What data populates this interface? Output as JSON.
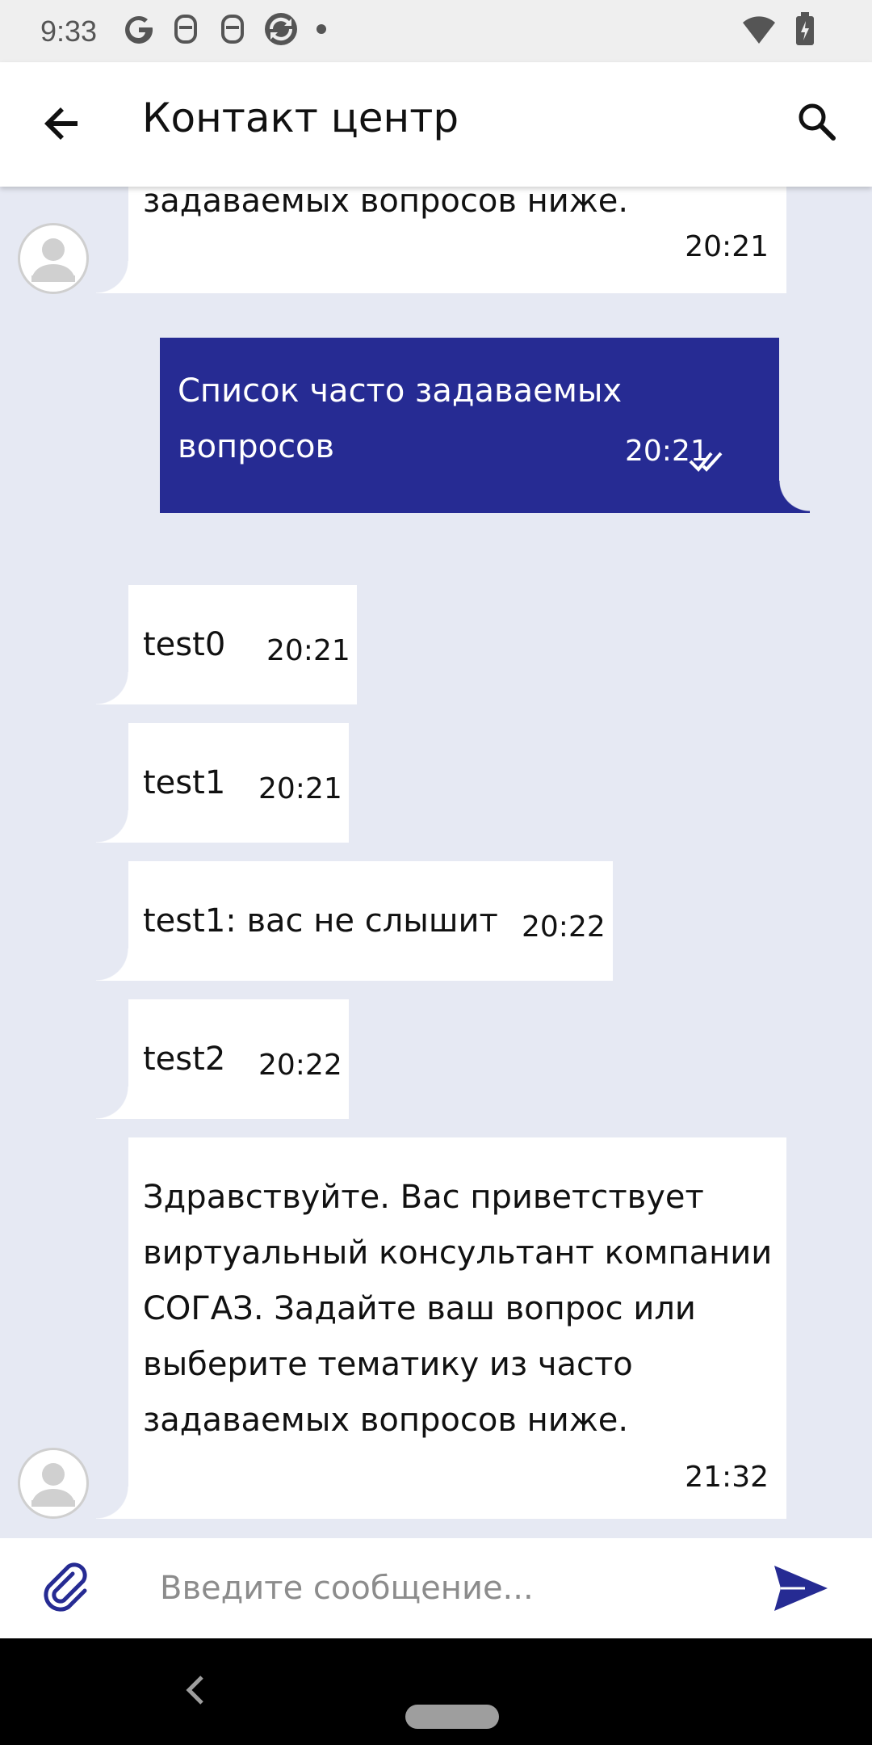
{
  "status_bar": {
    "time": "9:33",
    "icons": [
      "google-icon",
      "notification-icon",
      "notification-icon",
      "sync-icon",
      "dot-icon"
    ],
    "right_icons": [
      "wifi-icon",
      "battery-charging-icon"
    ]
  },
  "app_bar": {
    "title": "Контакт центр"
  },
  "messages": [
    {
      "direction": "in",
      "text": "задаваемых вопросов ниже.",
      "time": "20:21",
      "has_avatar": true
    },
    {
      "direction": "out",
      "lines": [
        "Список часто задаваемых",
        "вопросов"
      ],
      "time": "20:21",
      "status": "read"
    },
    {
      "direction": "in",
      "text": "test0",
      "time": "20:21"
    },
    {
      "direction": "in",
      "text": "test1",
      "time": "20:21"
    },
    {
      "direction": "in",
      "text": "test1: вас не слышит",
      "time": "20:22"
    },
    {
      "direction": "in",
      "text": "test2",
      "time": "20:22"
    },
    {
      "direction": "in",
      "lines": [
        "Здравствуйте. Вас приветствует",
        "виртуальный консультант компании",
        "СОГАЗ. Задайте ваш вопрос или",
        "выберите тематику из часто",
        "задаваемых вопросов ниже."
      ],
      "time": "21:32",
      "has_avatar": true
    }
  ],
  "input": {
    "placeholder": "Введите сообщение...",
    "value": ""
  },
  "colors": {
    "background": "#e6e9f3",
    "accent": "#262b93",
    "bubble_in": "#ffffff"
  }
}
